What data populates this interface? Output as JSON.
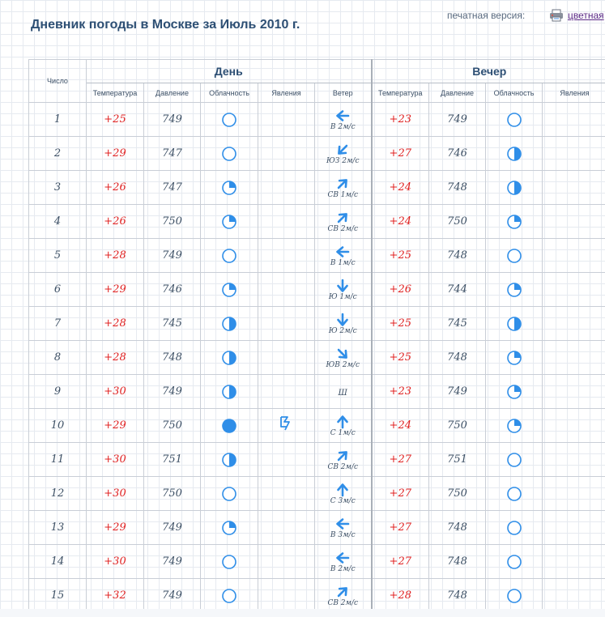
{
  "title": "Дневник погоды в Москве за Июль 2010 г.",
  "print_version": {
    "label": "печатная версия:",
    "link": "цветная"
  },
  "headers": {
    "date": "Число",
    "day": "День",
    "evening": "Вечер",
    "day_columns": [
      "Температура",
      "Давление",
      "Облачность",
      "Явления",
      "Ветер"
    ],
    "evening_columns": [
      "Температура",
      "Давление",
      "Облачность",
      "Явления"
    ]
  },
  "colors": {
    "title": "#2d4f74",
    "temp": "#e02020",
    "icon": "#2f8ee8"
  },
  "rows": [
    {
      "num": "1",
      "dt": "+25",
      "dp": "749",
      "dc": "clear",
      "dph": "",
      "wd": "W",
      "wl": "В 2м/с",
      "et": "+23",
      "ep": "749",
      "ec": "clear"
    },
    {
      "num": "2",
      "dt": "+29",
      "dp": "747",
      "dc": "clear",
      "dph": "",
      "wd": "SW",
      "wl": "ЮЗ 2м/с",
      "et": "+27",
      "ep": "746",
      "ec": "half"
    },
    {
      "num": "3",
      "dt": "+26",
      "dp": "747",
      "dc": "quarter",
      "dph": "",
      "wd": "NE",
      "wl": "СВ 1м/с",
      "et": "+24",
      "ep": "748",
      "ec": "half"
    },
    {
      "num": "4",
      "dt": "+26",
      "dp": "750",
      "dc": "quarter",
      "dph": "",
      "wd": "NE",
      "wl": "СВ 2м/с",
      "et": "+24",
      "ep": "750",
      "ec": "quarter"
    },
    {
      "num": "5",
      "dt": "+28",
      "dp": "749",
      "dc": "clear",
      "dph": "",
      "wd": "W",
      "wl": "В 1м/с",
      "et": "+25",
      "ep": "748",
      "ec": "clear"
    },
    {
      "num": "6",
      "dt": "+29",
      "dp": "746",
      "dc": "quarter",
      "dph": "",
      "wd": "S",
      "wl": "Ю 1м/с",
      "et": "+26",
      "ep": "744",
      "ec": "quarter"
    },
    {
      "num": "7",
      "dt": "+28",
      "dp": "745",
      "dc": "half",
      "dph": "",
      "wd": "S",
      "wl": "Ю 2м/с",
      "et": "+25",
      "ep": "745",
      "ec": "half"
    },
    {
      "num": "8",
      "dt": "+28",
      "dp": "748",
      "dc": "half",
      "dph": "",
      "wd": "SE",
      "wl": "ЮВ 2м/с",
      "et": "+25",
      "ep": "748",
      "ec": "quarter"
    },
    {
      "num": "9",
      "dt": "+30",
      "dp": "749",
      "dc": "half",
      "dph": "",
      "wd": "",
      "wl": "Ш",
      "et": "+23",
      "ep": "749",
      "ec": "quarter"
    },
    {
      "num": "10",
      "dt": "+29",
      "dp": "750",
      "dc": "full",
      "dph": "thunder",
      "wd": "N",
      "wl": "С 1м/с",
      "et": "+24",
      "ep": "750",
      "ec": "quarter"
    },
    {
      "num": "11",
      "dt": "+30",
      "dp": "751",
      "dc": "half",
      "dph": "",
      "wd": "NE",
      "wl": "СВ 2м/с",
      "et": "+27",
      "ep": "751",
      "ec": "clear"
    },
    {
      "num": "12",
      "dt": "+30",
      "dp": "750",
      "dc": "clear",
      "dph": "",
      "wd": "N",
      "wl": "С 3м/с",
      "et": "+27",
      "ep": "750",
      "ec": "clear"
    },
    {
      "num": "13",
      "dt": "+29",
      "dp": "749",
      "dc": "quarter",
      "dph": "",
      "wd": "W",
      "wl": "В 3м/с",
      "et": "+27",
      "ep": "748",
      "ec": "clear"
    },
    {
      "num": "14",
      "dt": "+30",
      "dp": "749",
      "dc": "clear",
      "dph": "",
      "wd": "W",
      "wl": "В 2м/с",
      "et": "+27",
      "ep": "748",
      "ec": "clear"
    },
    {
      "num": "15",
      "dt": "+32",
      "dp": "749",
      "dc": "clear",
      "dph": "",
      "wd": "NE",
      "wl": "СВ 2м/с",
      "et": "+28",
      "ep": "748",
      "ec": "clear"
    }
  ]
}
